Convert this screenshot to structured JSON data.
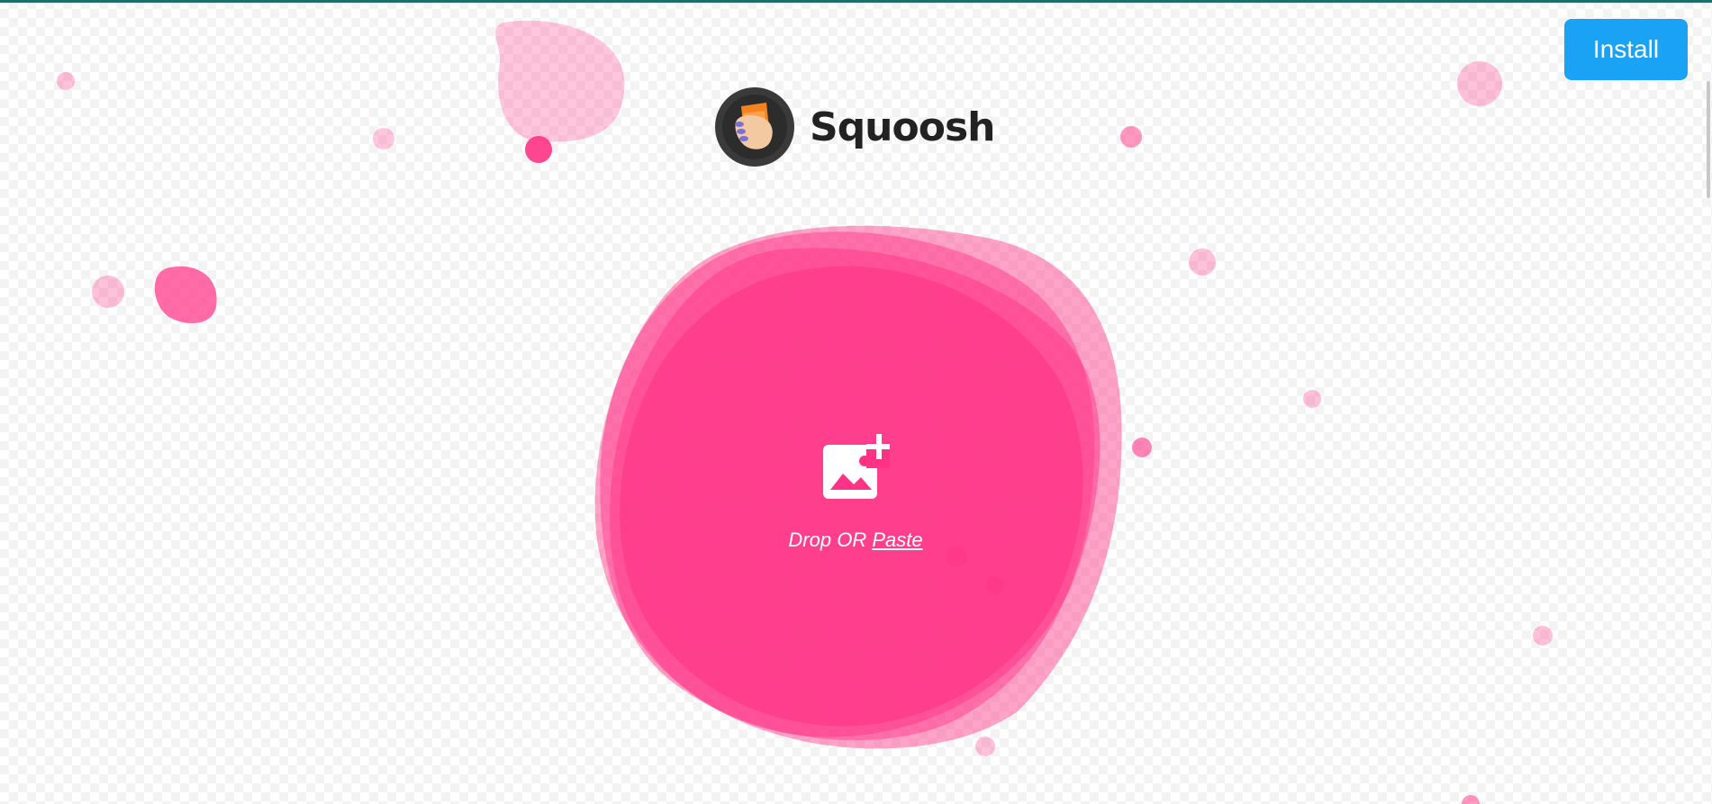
{
  "app": {
    "name": "Squoosh",
    "install_label": "Install"
  },
  "drop": {
    "drop_label": "Drop",
    "or_label": "OR",
    "paste_label": "Paste"
  },
  "icons": {
    "logo": "squoosh-logo-icon",
    "add_image": "add-image-icon"
  },
  "colors": {
    "accent_pink": "#ff3385",
    "install_blue": "#1aa3f5",
    "brand_text": "#222222",
    "top_line": "#1e6f6a"
  }
}
